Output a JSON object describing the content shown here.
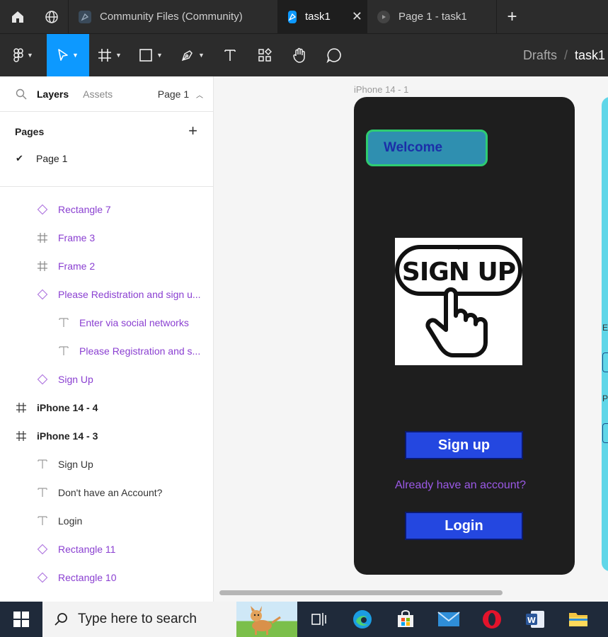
{
  "tabs": [
    {
      "label": "Community Files (Community)",
      "active": false
    },
    {
      "label": "task1",
      "active": true
    },
    {
      "label": "Page 1 - task1",
      "active": false
    }
  ],
  "breadcrumb": {
    "parent": "Drafts",
    "separator": "/",
    "file": "task1"
  },
  "left_panel": {
    "tab_layers": "Layers",
    "tab_assets": "Assets",
    "page_selector": "Page 1",
    "pages_title": "Pages",
    "pages": [
      {
        "label": "Page 1",
        "checked": true
      }
    ],
    "layers": [
      {
        "label": "Rectangle 7",
        "icon": "component-icon",
        "indent": 1,
        "style": "purple"
      },
      {
        "label": "Frame 3",
        "icon": "frame-icon",
        "indent": 1,
        "style": "purple"
      },
      {
        "label": "Frame 2",
        "icon": "frame-icon",
        "indent": 1,
        "style": "purple"
      },
      {
        "label": "Please Redistration and sign u...",
        "icon": "component-icon",
        "indent": 1,
        "style": "purple"
      },
      {
        "label": "Enter via social networks",
        "icon": "text-icon",
        "indent": 2,
        "style": "purple"
      },
      {
        "label": "Please Registration and s...",
        "icon": "text-icon",
        "indent": 2,
        "style": "purple"
      },
      {
        "label": "Sign Up",
        "icon": "component-icon",
        "indent": 1,
        "style": "purple"
      },
      {
        "label": "iPhone 14 - 4",
        "icon": "frame-icon",
        "indent": 0,
        "style": "bold"
      },
      {
        "label": "iPhone 14 - 3",
        "icon": "frame-icon",
        "indent": 0,
        "style": "bold"
      },
      {
        "label": "Sign Up",
        "icon": "text-icon",
        "indent": 1,
        "style": "dark"
      },
      {
        "label": "Don't have an Account?",
        "icon": "text-icon",
        "indent": 1,
        "style": "dark"
      },
      {
        "label": "Login",
        "icon": "text-icon",
        "indent": 1,
        "style": "dark"
      },
      {
        "label": "Rectangle 11",
        "icon": "component-icon",
        "indent": 1,
        "style": "purple"
      },
      {
        "label": "Rectangle 10",
        "icon": "component-icon",
        "indent": 1,
        "style": "purple"
      }
    ]
  },
  "canvas": {
    "frame_label": "iPhone 14 - 1",
    "welcome": "Welcome",
    "image_text": "SIGN UP",
    "signup_button": "Sign up",
    "already_text": "Already have an account?",
    "login_button": "Login",
    "side_labels": [
      "E",
      "P"
    ]
  },
  "taskbar": {
    "search_placeholder": "Type here to search"
  },
  "colors": {
    "accent": "#0d99ff",
    "layer_purple": "#8a3fd1",
    "button_blue": "#2447e0",
    "welcome_bg": "#2f8fb0",
    "welcome_border": "#2ecc71"
  }
}
